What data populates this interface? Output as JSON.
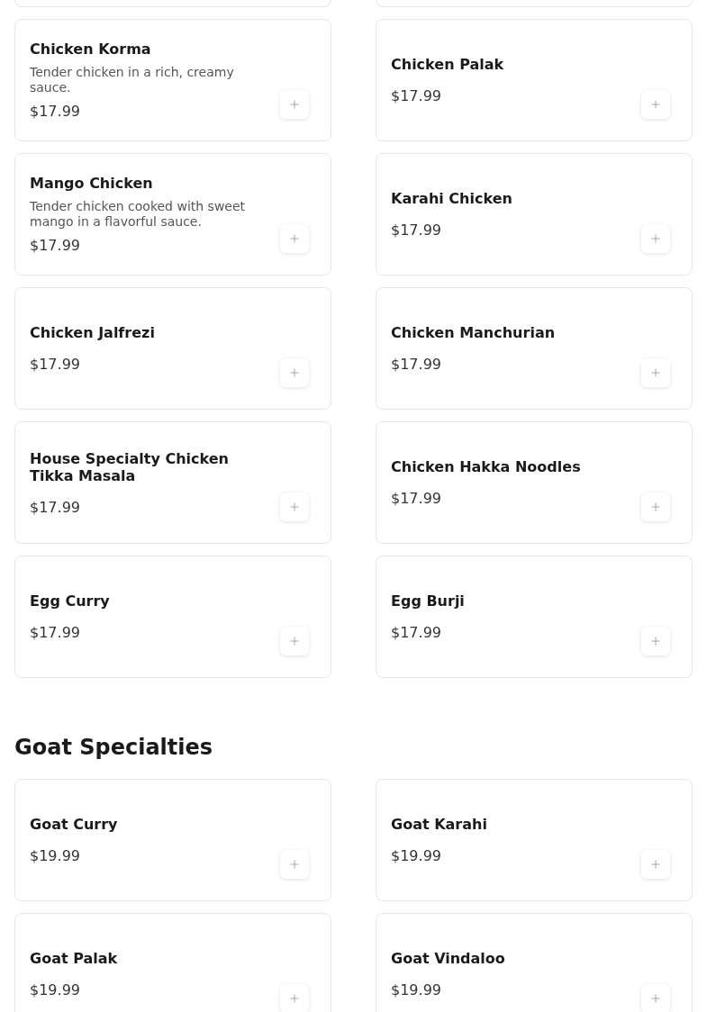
{
  "sections": [
    {
      "items": [
        {
          "name": "Chicken Korma",
          "description": "Tender chicken in a rich, creamy sauce.",
          "price": "$17.99"
        },
        {
          "name": "Chicken Palak",
          "price": "$17.99"
        },
        {
          "name": "Mango Chicken",
          "description": "Tender chicken cooked with sweet mango in a flavorful sauce.",
          "price": "$17.99"
        },
        {
          "name": "Karahi Chicken",
          "price": "$17.99"
        },
        {
          "name": "Chicken Jalfrezi",
          "price": "$17.99"
        },
        {
          "name": "Chicken Manchurian",
          "price": "$17.99"
        },
        {
          "name": "House Specialty Chicken Tikka Masala",
          "price": "$17.99"
        },
        {
          "name": "Chicken Hakka Noodles",
          "price": "$17.99"
        },
        {
          "name": "Egg Curry",
          "price": "$17.99"
        },
        {
          "name": "Egg Burji",
          "price": "$17.99"
        }
      ]
    },
    {
      "heading": "Goat Specialties",
      "items": [
        {
          "name": "Goat Curry",
          "price": "$19.99"
        },
        {
          "name": "Goat Karahi",
          "price": "$19.99"
        },
        {
          "name": "Goat Palak",
          "price": "$19.99"
        },
        {
          "name": "Goat Vindaloo",
          "price": "$19.99"
        }
      ]
    }
  ]
}
